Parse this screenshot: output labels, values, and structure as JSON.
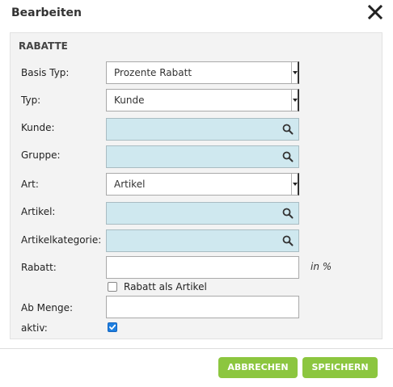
{
  "dialog": {
    "title": "Bearbeiten",
    "close_icon": "close-icon"
  },
  "section": {
    "title": "RABATTE"
  },
  "form": {
    "basis_typ": {
      "label": "Basis Typ:",
      "value": "Prozente Rabatt"
    },
    "typ": {
      "label": "Typ:",
      "value": "Kunde"
    },
    "kunde": {
      "label": "Kunde:",
      "value": "",
      "icon": "search-icon"
    },
    "gruppe": {
      "label": "Gruppe:",
      "value": "",
      "icon": "search-icon"
    },
    "art": {
      "label": "Art:",
      "value": "Artikel"
    },
    "artikel": {
      "label": "Artikel:",
      "value": "",
      "icon": "search-icon"
    },
    "artikelkategorie": {
      "label": "Artikelkategorie:",
      "value": "",
      "icon": "search-icon"
    },
    "rabatt": {
      "label": "Rabatt:",
      "value": "",
      "unit": "in %"
    },
    "rabatt_als_artikel": {
      "label": "Rabatt als Artikel",
      "checked": false
    },
    "ab_menge": {
      "label": "Ab Menge:",
      "value": ""
    },
    "aktiv": {
      "label": "aktiv:",
      "checked": true
    }
  },
  "buttons": {
    "cancel": "ABBRECHEN",
    "save": "SPEICHERN"
  },
  "colors": {
    "accent_button": "#8cc63f",
    "search_field": "#cfe8ef",
    "checkbox_checked": "#1e7fe0"
  }
}
